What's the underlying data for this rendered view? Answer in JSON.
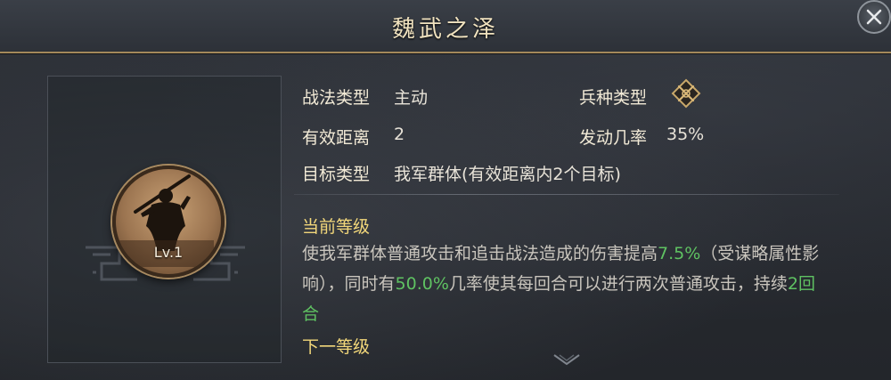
{
  "header": {
    "title": "魏武之泽"
  },
  "portrait": {
    "level": "Lv.1"
  },
  "info": {
    "skill_type_label": "战法类型",
    "skill_type_value": "主动",
    "troop_type_label": "兵种类型",
    "range_label": "有效距离",
    "range_value": "2",
    "trigger_rate_label": "发动几率",
    "trigger_rate_value": "35%",
    "target_label": "目标类型",
    "target_value": "我军群体(有效距离内2个目标)"
  },
  "current_level": {
    "heading": "当前等级",
    "desc": {
      "p1": "使我军群体普通攻击和追击战法造成的伤害提高",
      "v1": "7.5%",
      "p2": "（受谋略属性影响），同时有",
      "v2": "50.0%",
      "p3": "几率使其每回合可以进行两次普通攻击，持续",
      "v3": "2回合"
    }
  },
  "next_level": {
    "heading": "下一等级"
  },
  "colors": {
    "accent_gold": "#f2d77a",
    "highlight_green": "#5fc262",
    "title_color": "#f0e2bf"
  },
  "icons": {
    "close": "close-icon",
    "troop": "troop-type-icon",
    "scroll": "chevron-down-icon"
  }
}
